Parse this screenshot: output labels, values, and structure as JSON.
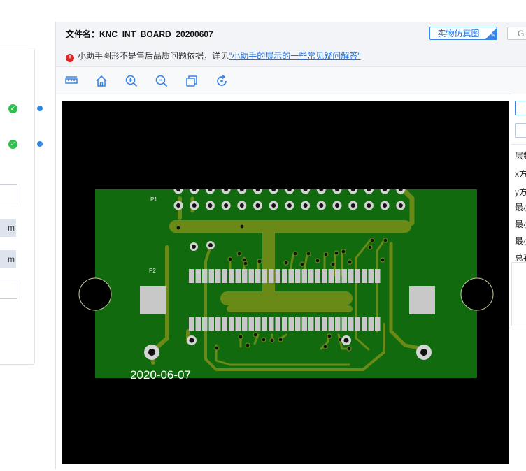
{
  "header": {
    "file_label": "文件名：",
    "file_name": "KNC_INT_BOARD_20200607",
    "sim_button": "实物仿真图",
    "g_button": "G"
  },
  "notice": {
    "text": "小助手图形不是售后品质问题依据，详见",
    "link": "\"小助手的展示的一些常见疑问解答\""
  },
  "toolbar": {
    "icons": [
      "ruler-icon",
      "home-icon",
      "zoom-in-icon",
      "zoom-out-icon",
      "layers-icon",
      "rotate-icon"
    ]
  },
  "left_panel": {
    "unit1": "m",
    "unit2": "m"
  },
  "board": {
    "silk_p1": "P1",
    "silk_p2": "P2",
    "date": "2020-06-07"
  },
  "side_panel": {
    "labels": [
      "层数",
      "x方",
      "y方",
      "最小",
      "最小",
      "最小",
      "总孔"
    ]
  },
  "colors": {
    "board_green": "#116b0e",
    "trace_olive": "#6a8a17",
    "pad_grey": "#c8c8c8",
    "accent": "#3a86e6"
  }
}
